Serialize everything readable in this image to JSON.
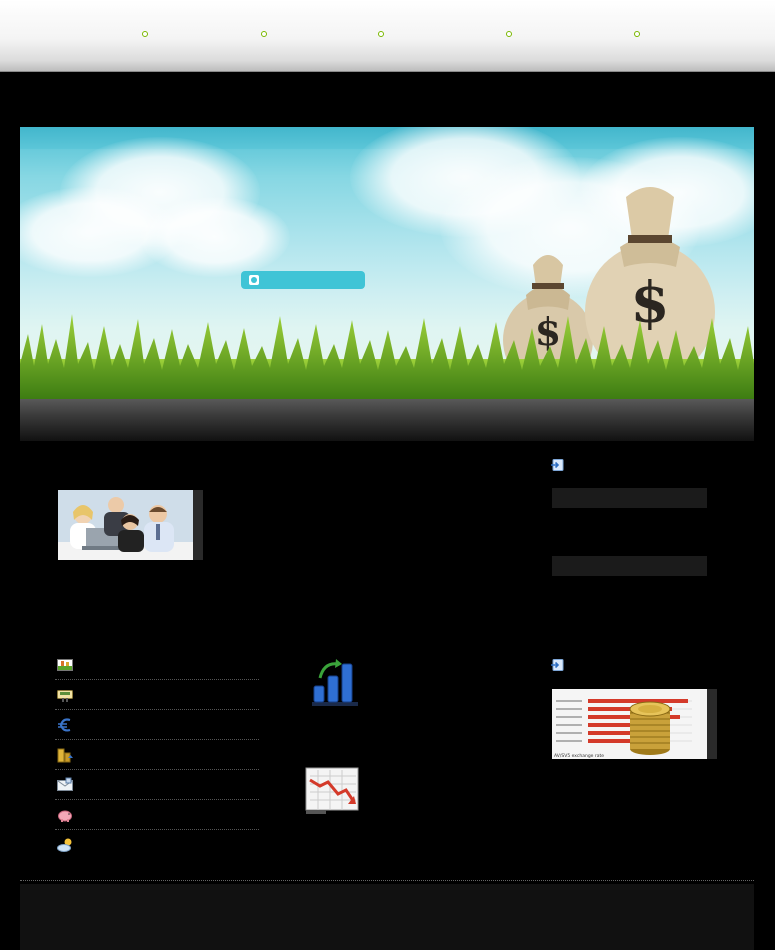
{
  "nav": {
    "items": [
      {
        "label": ""
      },
      {
        "label": ""
      },
      {
        "label": ""
      },
      {
        "label": ""
      },
      {
        "label": ""
      }
    ]
  },
  "hero": {
    "search_placeholder": ""
  },
  "sidebar": {
    "top_header_icon": "arrow-in-box-icon",
    "bottom_header_icon": "arrow-in-box-icon"
  },
  "list": {
    "items": [
      {
        "icon": "chart-landscape-icon",
        "label": ""
      },
      {
        "icon": "cash-register-icon",
        "label": ""
      },
      {
        "icon": "euro-icon",
        "label": ""
      },
      {
        "icon": "buildings-icon",
        "label": ""
      },
      {
        "icon": "mail-document-icon",
        "label": ""
      },
      {
        "icon": "piggy-bank-icon",
        "label": ""
      },
      {
        "icon": "weather-cloud-icon",
        "label": ""
      }
    ]
  },
  "gold_photo": {
    "caption": "AV/SV5 exchange rate"
  },
  "colors": {
    "accent": "#7ab800",
    "hero_button": "#3fc4d6",
    "background": "#000000"
  }
}
